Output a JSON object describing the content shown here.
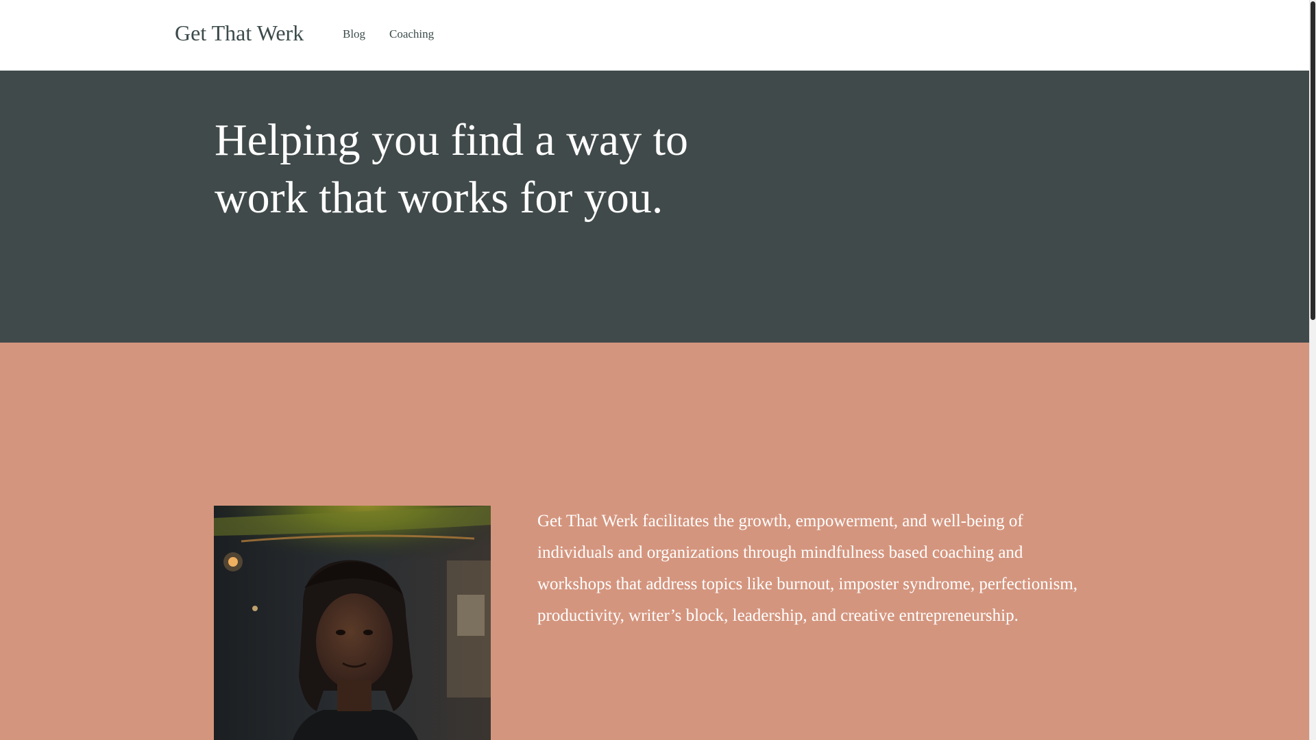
{
  "header": {
    "brand": "Get That Werk",
    "nav": [
      {
        "label": "Blog"
      },
      {
        "label": "Coaching"
      }
    ]
  },
  "hero": {
    "title": "Helping you find a way to work that works for you."
  },
  "about": {
    "portrait_alt": "portrait-photo",
    "text": "Get That Werk facilitates the growth, empowerment, and well-being of individuals and organizations through mindfulness based coaching and workshops that address topics like burnout, imposter syndrome, perfectionism, productivity, writer’s block, leadership, and creative entrepreneurship."
  },
  "colors": {
    "header_bg": "#ffffff",
    "hero_bg": "#414a4a",
    "about_bg": "#d4957e",
    "text_dark": "#3c4a4a",
    "text_light": "#ffffff"
  }
}
